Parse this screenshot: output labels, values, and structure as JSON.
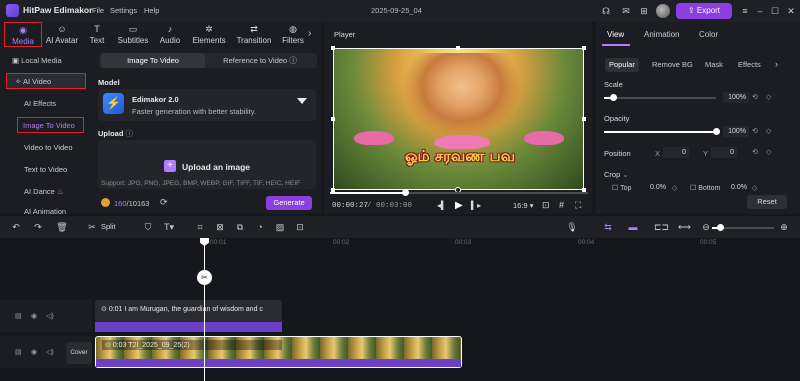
{
  "app": {
    "name": "HitPaw Edimakor",
    "menus": [
      "File",
      "Settings",
      "Help"
    ],
    "project_title": "2025-09-25_04",
    "export_label": "Export"
  },
  "tools": [
    {
      "icon": "media-icon",
      "glyph": "◉",
      "label": "Media"
    },
    {
      "icon": "ai-avatar-icon",
      "glyph": "☺",
      "label": "AI Avatar"
    },
    {
      "icon": "text-icon",
      "glyph": "T",
      "label": "Text"
    },
    {
      "icon": "subtitles-icon",
      "glyph": "▭",
      "label": "Subtitles"
    },
    {
      "icon": "audio-icon",
      "glyph": "♪",
      "label": "Audio"
    },
    {
      "icon": "elements-icon",
      "glyph": "✲",
      "label": "Elements"
    },
    {
      "icon": "transition-icon",
      "glyph": "⇄",
      "label": "Transition"
    },
    {
      "icon": "filters-icon",
      "glyph": "◍",
      "label": "Filters"
    }
  ],
  "side_nav": {
    "local_media": "Local Media",
    "ai_video": "AI Video",
    "items": [
      "AI Effects",
      "Image To Video",
      "Video to Video",
      "Text to Video",
      "AI Dance",
      "AI Animation"
    ]
  },
  "mode_tabs": [
    "Image To Video",
    "Reference to Video"
  ],
  "model": {
    "heading": "Model",
    "name": "Edimakor 2.0",
    "description": "Faster generation with better stability."
  },
  "upload": {
    "heading": "Upload",
    "button_label": "Upload an image",
    "support_text": "Support: JPG, PNG, JPEG, BMP, WEBP, GIF, TIFF, TIF, HEIC, HEIF"
  },
  "credits": {
    "used": "160",
    "total": "/10163",
    "generate_label": "Generate"
  },
  "player": {
    "title": "Player",
    "overlay_text": "ஓம் சரவண பவ",
    "current_time": "00:00:27",
    "total_time": "/ 00:03:00",
    "aspect": "16:9",
    "progress": 0.29
  },
  "properties": {
    "tabs": [
      "View",
      "Animation",
      "Color"
    ],
    "sub_tabs": [
      "Popular",
      "Remove BG",
      "Mask",
      "Effects"
    ],
    "scale_label": "Scale",
    "scale_value": "100%",
    "scale_level": 0.08,
    "opacity_label": "Opacity",
    "opacity_value": "100%",
    "opacity_level": 1.0,
    "position_label": "Position",
    "pos_x_label": "X",
    "pos_x": "0",
    "pos_y_label": "Y",
    "pos_y": "0",
    "crop_label": "Crop",
    "crop_top_label": "Top",
    "crop_top": "0.0%",
    "crop_bottom_label": "Bottom",
    "crop_bottom": "0.0%",
    "reset_label": "Reset"
  },
  "timeline": {
    "split_label": "Split",
    "ruler": [
      "00:01",
      "00:02",
      "00:03",
      "00:04",
      "00:05"
    ],
    "text_clip": "0:01 I am Murugan, the guardian of wisdom and c",
    "video_clip": "0:03 T2I_2025_09_25(2)",
    "cover_label": "Cover"
  },
  "colors": {
    "accent": "#8b3fe0",
    "accent_text": "#b37cff",
    "highlight_box": "#e0202a"
  }
}
